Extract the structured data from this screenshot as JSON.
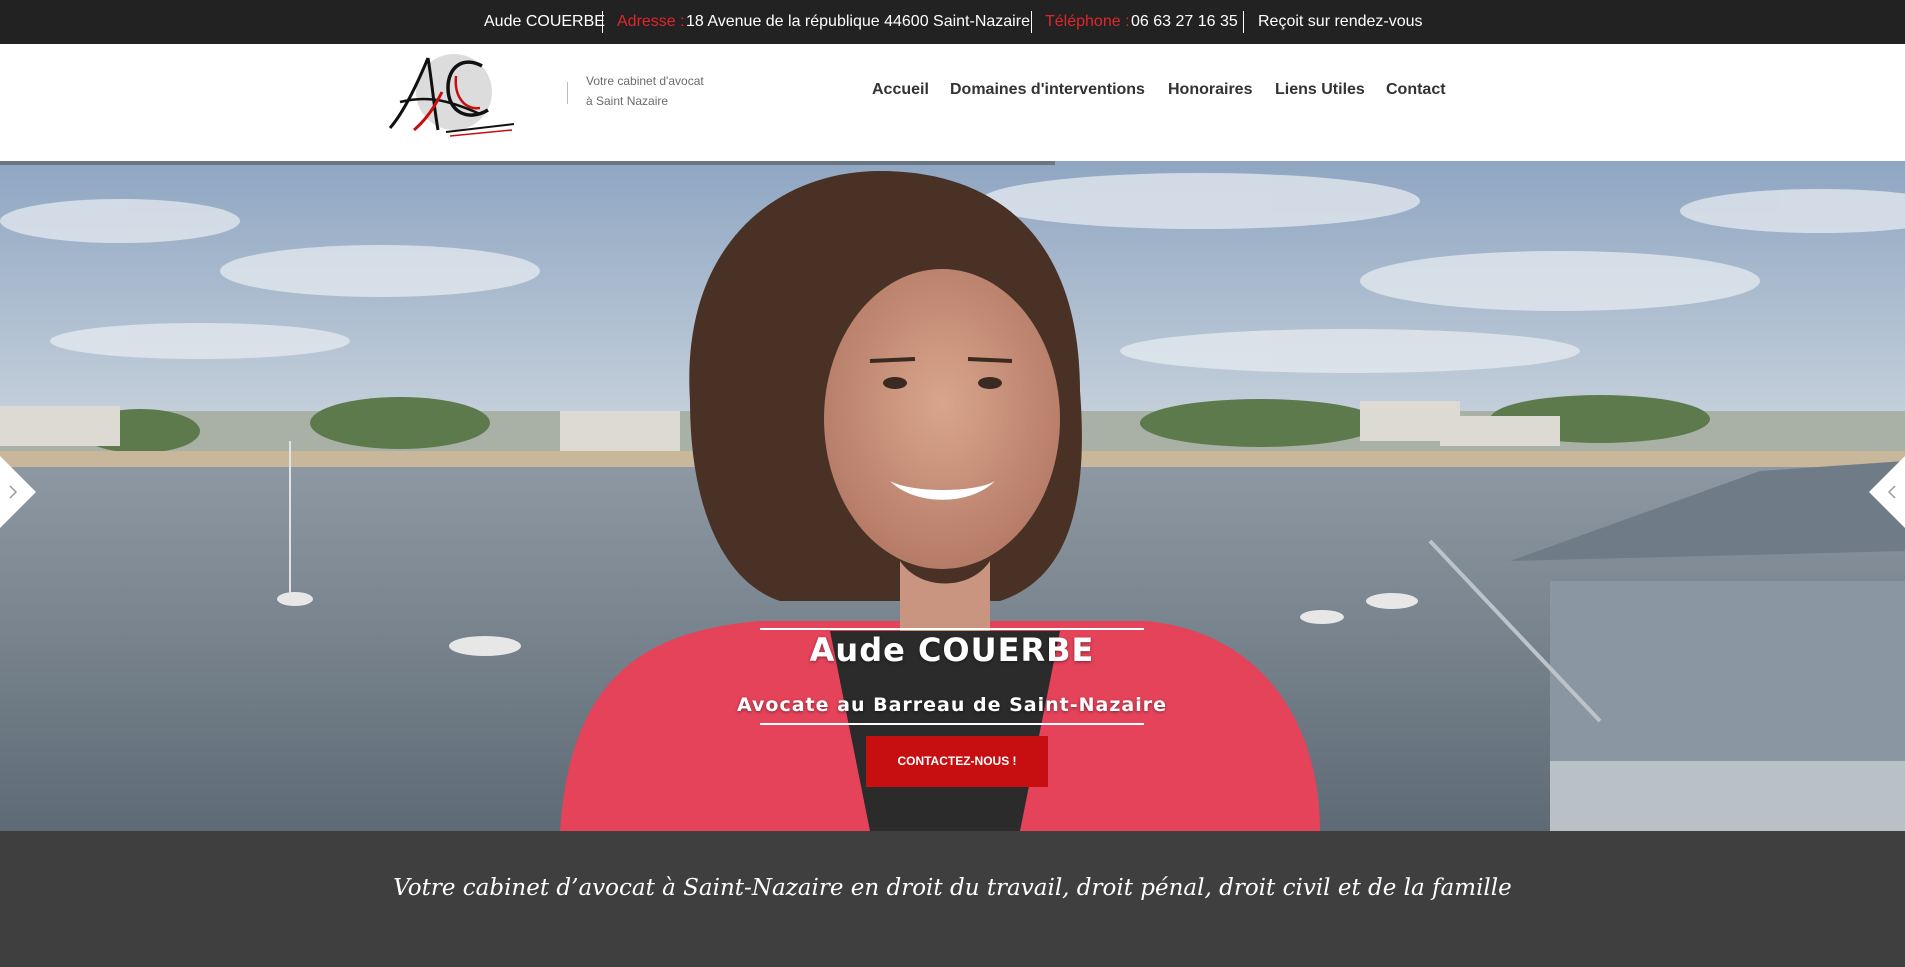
{
  "topbar": {
    "name": "Aude COUERBE",
    "address_label": "Adresse :",
    "address_value": "18 Avenue de la république 44600 Saint-Nazaire",
    "phone_label": "Téléphone :",
    "phone_value": "06 63 27 16 35",
    "appointment": "Reçoit sur rendez-vous"
  },
  "header": {
    "logo_name": "ac-logo",
    "tagline_line1": "Votre cabinet d'avocat",
    "tagline_line2": "à Saint Nazaire",
    "nav": [
      {
        "label": "Accueil"
      },
      {
        "label": "Domaines d'interventions"
      },
      {
        "label": "Honoraires"
      },
      {
        "label": "Liens Utiles"
      },
      {
        "label": "Contact"
      }
    ]
  },
  "hero": {
    "title": "Aude COUERBE",
    "subtitle": "Avocate au Barreau de Saint-Nazaire",
    "cta_label": "CONTACTEZ-NOUS !",
    "prev_icon": "chevron-left-icon",
    "next_icon": "chevron-right-icon"
  },
  "band": {
    "text": "Votre cabinet d’avocat à Saint-Nazaire en droit du travail, droit pénal, droit civil et de la famille"
  },
  "colors": {
    "topbar_bg": "#222222",
    "accent_red": "#c70f12",
    "label_red": "#e0252b",
    "band_bg": "#3f3f3f"
  }
}
